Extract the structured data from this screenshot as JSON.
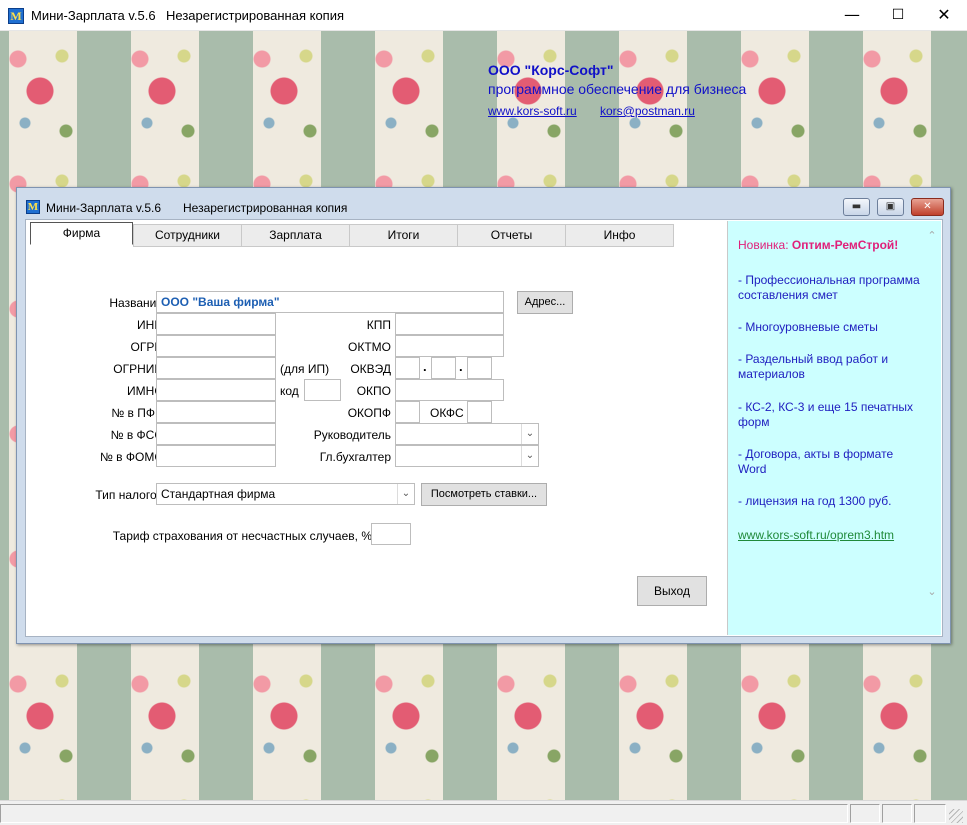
{
  "main_window": {
    "icon_letter": "M",
    "title": "Мини-Зарплата v.5.6",
    "subtitle": "Незарегистрированная копия",
    "minimize": "—",
    "maximize": "☐",
    "close": "✕"
  },
  "company": {
    "name": "ООО \"Корс-Софт\"",
    "tagline": "программное обеспечение для бизнеса",
    "site": "www.kors-soft.ru",
    "email": "kors@postman.ru"
  },
  "dialog": {
    "icon_letter": "M",
    "title": "Мини-Зарплата v.5.6",
    "subtitle": "Незарегистрированная копия",
    "minimize": "▬",
    "restore": "▣",
    "close": "✕"
  },
  "tabs": [
    "Фирма",
    "Сотрудники",
    "Зарплата",
    "Итоги",
    "Отчеты",
    "Инфо"
  ],
  "active_tab": "Фирма",
  "form": {
    "name_label": "Название",
    "name_value": "ООО \"Ваша фирма\"",
    "address_button": "Адрес...",
    "inn_label": "ИНН",
    "kpp_label": "КПП",
    "ogrn_label": "ОГРН",
    "oktmo_label": "ОКТМО",
    "ogrnip_label": "ОГРНИП",
    "for_ip_label": "(для ИП)",
    "okved_label": "ОКВЭД",
    "imns_label": "ИМНС",
    "kod_label": "код",
    "okpo_label": "ОКПО",
    "pfr_label": "№ в ПФР",
    "okopf_label": "ОКОПФ",
    "okfs_label": "ОКФС",
    "fss_label": "№ в ФСС",
    "director_label": "Руководитель",
    "foms_label": "№ в ФОМС",
    "accountant_label": "Гл.бухгалтер",
    "tax_type_label": "Тип налогов",
    "tax_type_value": "Стандартная фирма",
    "view_rates_button": "Посмотреть ставки...",
    "accident_rate_label": "Тариф страхования от несчастных случаев, %",
    "exit_button": "Выход"
  },
  "ad": {
    "new_prefix": "Новинка: ",
    "product": "Оптим-РемСтрой!",
    "items": [
      "- Профессиональная программа составления смет",
      "- Многоуровневые сметы",
      "- Раздельный ввод работ и материалов",
      "- КС-2, КС-3 и еще 15 печатных форм",
      "- Договора, акты в формате Word",
      "- лицензия на год 1300 руб."
    ],
    "link": "www.kors-soft.ru/oprem3.htm"
  },
  "icons": {
    "dropdown": "chevron-down-icon",
    "scroll_up": "chevron-up-icon",
    "scroll_down": "chevron-down-icon"
  },
  "colors": {
    "ad_background": "#ccffff",
    "ad_text": "#2020c0",
    "ad_highlight": "#e0207a",
    "ad_link": "#1f8a3a",
    "company_text": "#1010c8",
    "firm_name_text": "#1d5fb3"
  }
}
